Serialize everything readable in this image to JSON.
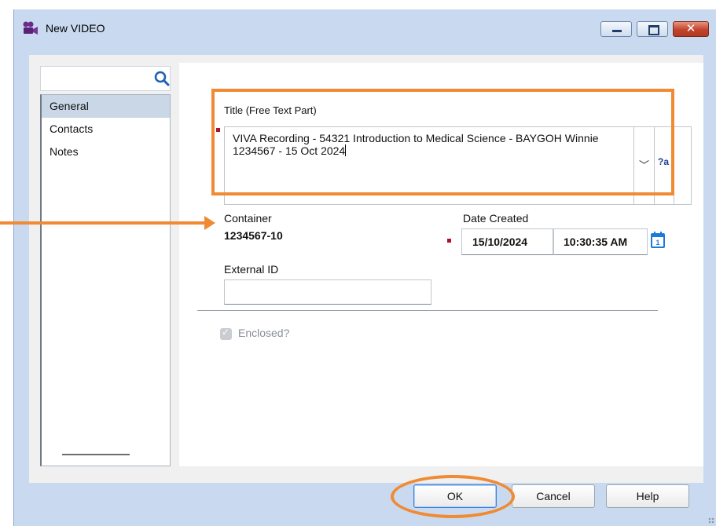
{
  "window": {
    "title": "New VIDEO",
    "icon": "video-camera-icon",
    "controls": {
      "minimize": "minimize-icon",
      "maximize": "maximize-icon",
      "close": "close-icon",
      "close_glyph": "✕"
    }
  },
  "sidebar": {
    "search": {
      "value": "",
      "placeholder": "",
      "icon": "search-icon"
    },
    "items": [
      {
        "label": "General",
        "selected": true
      },
      {
        "label": "Contacts",
        "selected": false
      },
      {
        "label": "Notes",
        "selected": false
      }
    ]
  },
  "form": {
    "title": {
      "label": "Title (Free Text Part)",
      "value": "VIVA Recording - 54321 Introduction to Medical Science - BAYGOH Winnie 1234567 - 15 Oct 2024",
      "required": true,
      "dropdown_glyph": "﹀",
      "spell_glyph": "?a"
    },
    "container": {
      "label": "Container",
      "value": "1234567-10"
    },
    "date_created": {
      "label": "Date Created",
      "date": "15/10/2024",
      "time": "10:30:35 AM",
      "required": true,
      "calendar_icon": "calendar-icon"
    },
    "external_id": {
      "label": "External ID",
      "value": ""
    },
    "enclosed": {
      "label": "Enclosed?",
      "checked": true,
      "disabled": true
    }
  },
  "buttons": {
    "ok": "OK",
    "cancel": "Cancel",
    "help": "Help"
  },
  "colors": {
    "annotation": "#f08a33",
    "window_frame": "#c9daf0",
    "selected_item": "#c9d7e6",
    "required_marker": "#b0102a",
    "close_button": "#c3432b"
  }
}
